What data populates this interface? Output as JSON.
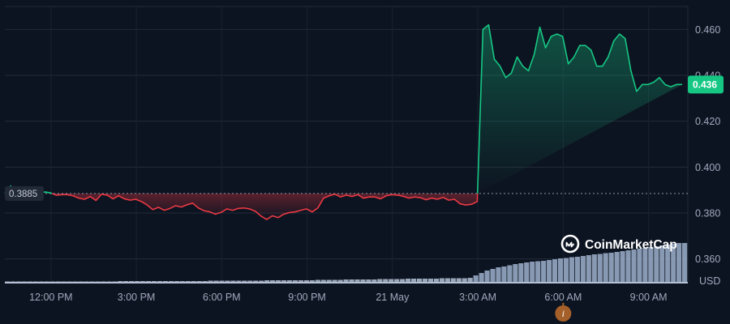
{
  "chart_data": {
    "type": "line",
    "ylim": [
      0.35,
      0.47
    ],
    "y_ticks": [
      "0.460",
      "0.440",
      "0.420",
      "0.400",
      "0.380",
      "0.360"
    ],
    "currency": "USD",
    "x_tick_labels": [
      "12:00 PM",
      "3:00 PM",
      "6:00 PM",
      "9:00 PM",
      "21 May",
      "3:00 AM",
      "6:00 AM",
      "9:00 AM"
    ],
    "reference_price": 0.3885,
    "reference_label": "0.3885",
    "current_price": 0.436,
    "current_label": "0.436",
    "grid": true,
    "colors": {
      "up": "#16c784",
      "down": "#ea3943",
      "background": "#0d1421",
      "volume": "#a8b6cc"
    },
    "series": [
      {
        "x_hours_from_start": [
          0,
          0.2,
          0.4,
          0.6,
          0.8,
          1.0,
          1.2,
          1.4,
          1.6,
          1.8,
          2.0,
          2.2,
          2.4,
          2.6,
          2.8,
          3.0,
          3.2,
          3.4,
          3.6,
          3.8,
          4.0,
          4.2,
          4.4,
          4.6,
          4.8,
          5.0,
          5.2,
          5.4,
          5.6,
          5.8,
          6.0,
          6.2,
          6.4,
          6.6,
          6.8,
          7.0,
          7.2,
          7.4,
          7.6,
          7.8,
          8.0,
          8.2,
          8.4,
          8.6,
          8.8,
          9.0,
          9.2,
          9.4,
          9.6,
          9.8,
          10.0,
          10.2,
          10.4,
          10.6,
          10.8,
          11.0,
          11.2,
          11.4,
          11.6,
          11.8,
          12.0,
          12.2,
          12.4,
          12.6,
          12.8,
          13.0,
          13.2,
          13.4,
          13.6,
          13.8,
          14.0,
          14.2,
          14.4,
          14.6,
          14.8,
          15.0,
          15.2,
          15.4,
          15.6,
          15.8,
          16.0,
          16.2,
          16.4,
          16.6,
          16.8,
          17.0,
          17.2,
          17.4,
          17.6,
          17.8,
          18.0,
          18.2,
          18.4,
          18.6,
          18.8,
          19.0,
          19.2,
          19.4,
          19.6,
          19.8,
          20.0,
          20.2,
          20.4,
          20.6,
          20.8,
          21.0,
          21.2,
          21.4,
          21.6,
          21.8,
          22.0,
          22.2,
          22.4,
          22.6,
          22.8,
          23.0,
          23.2,
          23.4,
          23.6,
          23.8,
          24.0
        ],
        "values": [
          0.3885,
          0.3918,
          0.3895,
          0.389,
          0.3885,
          0.3875,
          0.3882,
          0.3892,
          0.3888,
          0.3878,
          0.388,
          0.388,
          0.3875,
          0.3865,
          0.386,
          0.3872,
          0.3855,
          0.3882,
          0.3878,
          0.3862,
          0.3875,
          0.3862,
          0.3856,
          0.386,
          0.385,
          0.3835,
          0.3815,
          0.3825,
          0.3812,
          0.382,
          0.3832,
          0.3826,
          0.3836,
          0.3843,
          0.3822,
          0.381,
          0.3805,
          0.3795,
          0.3803,
          0.3818,
          0.3812,
          0.382,
          0.3822,
          0.3818,
          0.3808,
          0.3787,
          0.3772,
          0.3788,
          0.378,
          0.3795,
          0.3802,
          0.3805,
          0.3812,
          0.3818,
          0.3805,
          0.3822,
          0.3865,
          0.3875,
          0.3882,
          0.387,
          0.3878,
          0.3872,
          0.388,
          0.3865,
          0.387,
          0.387,
          0.3862,
          0.3875,
          0.388,
          0.3878,
          0.3873,
          0.3865,
          0.387,
          0.3867,
          0.3858,
          0.3865,
          0.386,
          0.3868,
          0.3856,
          0.386,
          0.384,
          0.3835,
          0.3838,
          0.385,
          0.46,
          0.462,
          0.447,
          0.444,
          0.439,
          0.441,
          0.448,
          0.444,
          0.442,
          0.449,
          0.461,
          0.452,
          0.457,
          0.458,
          0.457,
          0.445,
          0.448,
          0.453,
          0.453,
          0.451,
          0.444,
          0.444,
          0.448,
          0.455,
          0.458,
          0.456,
          0.442,
          0.433,
          0.436,
          0.436,
          0.437,
          0.439,
          0.436,
          0.435,
          0.436,
          0.436
        ]
      }
    ],
    "volume_relative": [
      0.05,
      0.05,
      0.05,
      0.05,
      0.05,
      0.05,
      0.05,
      0.05,
      0.05,
      0.05,
      0.05,
      0.05,
      0.05,
      0.05,
      0.05,
      0.05,
      0.05,
      0.05,
      0.05,
      0.05,
      0.06,
      0.06,
      0.06,
      0.06,
      0.06,
      0.06,
      0.06,
      0.06,
      0.06,
      0.06,
      0.06,
      0.06,
      0.06,
      0.06,
      0.06,
      0.06,
      0.07,
      0.07,
      0.07,
      0.07,
      0.07,
      0.07,
      0.07,
      0.07,
      0.07,
      0.07,
      0.08,
      0.08,
      0.08,
      0.08,
      0.08,
      0.08,
      0.08,
      0.08,
      0.08,
      0.09,
      0.09,
      0.09,
      0.09,
      0.09,
      0.1,
      0.1,
      0.1,
      0.1,
      0.1,
      0.1,
      0.11,
      0.11,
      0.11,
      0.11,
      0.11,
      0.12,
      0.12,
      0.12,
      0.12,
      0.12,
      0.12,
      0.13,
      0.13,
      0.13,
      0.13,
      0.13,
      0.14,
      0.2,
      0.26,
      0.32,
      0.36,
      0.4,
      0.42,
      0.45,
      0.48,
      0.5,
      0.52,
      0.54,
      0.55,
      0.56,
      0.58,
      0.6,
      0.62,
      0.63,
      0.65,
      0.66,
      0.68,
      0.7,
      0.72,
      0.73,
      0.75,
      0.76,
      0.78,
      0.8,
      0.82,
      0.84,
      0.86,
      0.88,
      0.9,
      0.92,
      0.94,
      0.96,
      0.98,
      1.0,
      1.0
    ],
    "brand": "CoinMarketCap",
    "event_marker": {
      "label": "i",
      "x_tick_index": 6
    }
  }
}
